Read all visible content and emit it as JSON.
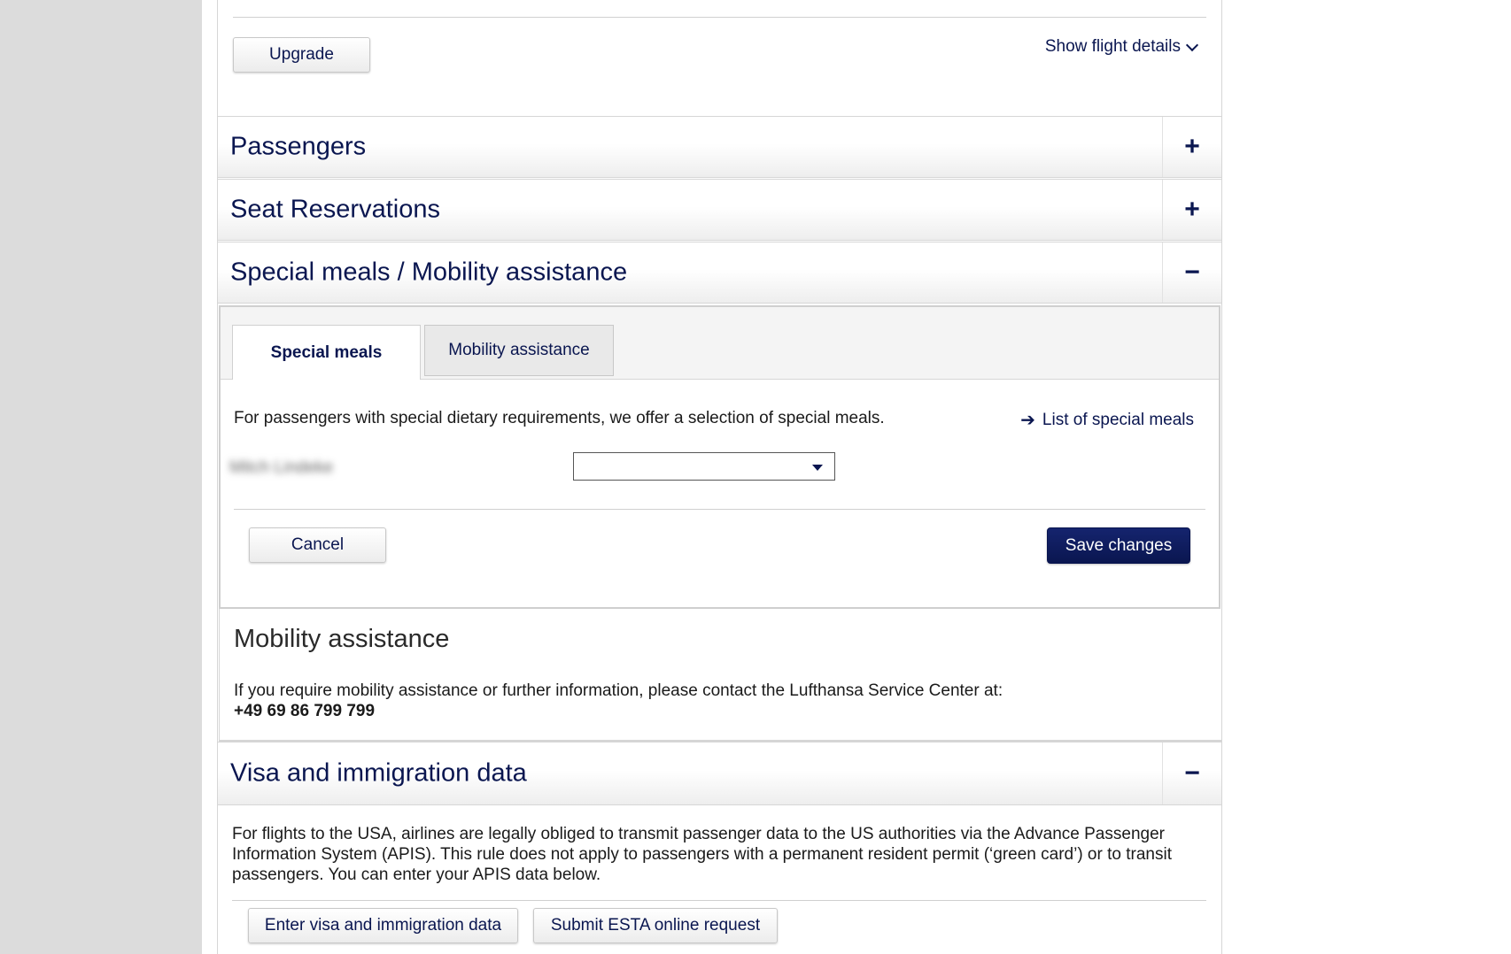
{
  "upgrade_label": "Upgrade",
  "show_flight_details": "Show flight details",
  "accordion": {
    "passengers": {
      "title": "Passengers",
      "toggle": "+"
    },
    "seats": {
      "title": "Seat Reservations",
      "toggle": "+"
    },
    "meals": {
      "title": "Special meals / Mobility assistance",
      "toggle": "−"
    },
    "visa": {
      "title": "Visa and immigration data",
      "toggle": "−"
    }
  },
  "tabs": {
    "special_meals": "Special meals",
    "mobility": "Mobility assistance"
  },
  "meals": {
    "description": "For passengers with special dietary requirements, we offer a selection of special meals.",
    "list_link": "List of special meals",
    "passenger_label": "Mitch Lindeke",
    "select_value": "",
    "cancel_label": "Cancel",
    "save_label": "Save changes"
  },
  "mobility": {
    "title": "Mobility assistance",
    "text": "If you require mobility assistance or further information, please contact the Lufthansa Service Center at:",
    "phone": "+49 69 86 799 799"
  },
  "visa": {
    "text": "For flights to the USA, airlines are legally obliged to transmit passenger data to the US authorities via the Advance Passenger Information System (APIS). This rule does not apply to passengers with a permanent resident permit (‘green card’) or to transit passengers. You can enter your APIS data below.",
    "enter_label": "Enter visa and immigration data",
    "esta_label": "Submit ESTA online request"
  },
  "colors": {
    "brand_navy": "#0a1650",
    "gutter_gray": "#dcdcdc"
  }
}
